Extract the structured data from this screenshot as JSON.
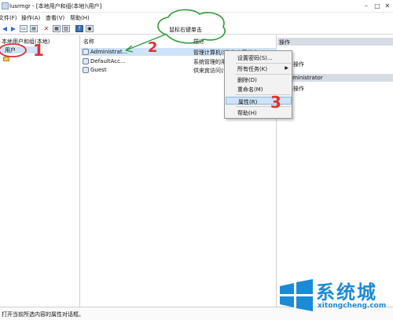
{
  "window": {
    "title": "lusrmgr - [本地用户和组(本地)\\用户]"
  },
  "menus": [
    "文件(F)",
    "操作(A)",
    "查看(V)",
    "帮助(H)"
  ],
  "tree": {
    "root": "本地用户和组(本地)",
    "users": "用户"
  },
  "columns": {
    "name": "名称",
    "description": "描述"
  },
  "users": [
    {
      "name": "Administrat...",
      "description": "管理计算机(域)的内置帐户"
    },
    {
      "name": "DefaultAcc...",
      "description": "系统管理的用户帐户。"
    },
    {
      "name": "Guest",
      "description": "供来宾访问计算机或访问域的内置帐户"
    }
  ],
  "context_menu": {
    "set_password": "设置密码(S)...",
    "all_tasks": "所有任务(K)",
    "delete": "删除(D)",
    "rename": "重命名(M)",
    "properties": "属性(R)",
    "help": "帮助(H)"
  },
  "actions_pane": {
    "header": "操作",
    "more_actions_1": "更多操作",
    "section2": "Administrator",
    "more_actions_2": "更多操作"
  },
  "status": "打开当前所选内容的属性对话框。",
  "annotations": {
    "hint": "鼠标右键单击",
    "marks": [
      "1",
      "2",
      "3"
    ]
  },
  "watermark": {
    "brand": "系统城",
    "site": "xitongcheng.com"
  },
  "colors": {
    "selection": "#cde3f7",
    "annotation_red": "#e03030",
    "annotation_green": "#2e9a3a",
    "brand_blue": "#1c8bd6"
  }
}
